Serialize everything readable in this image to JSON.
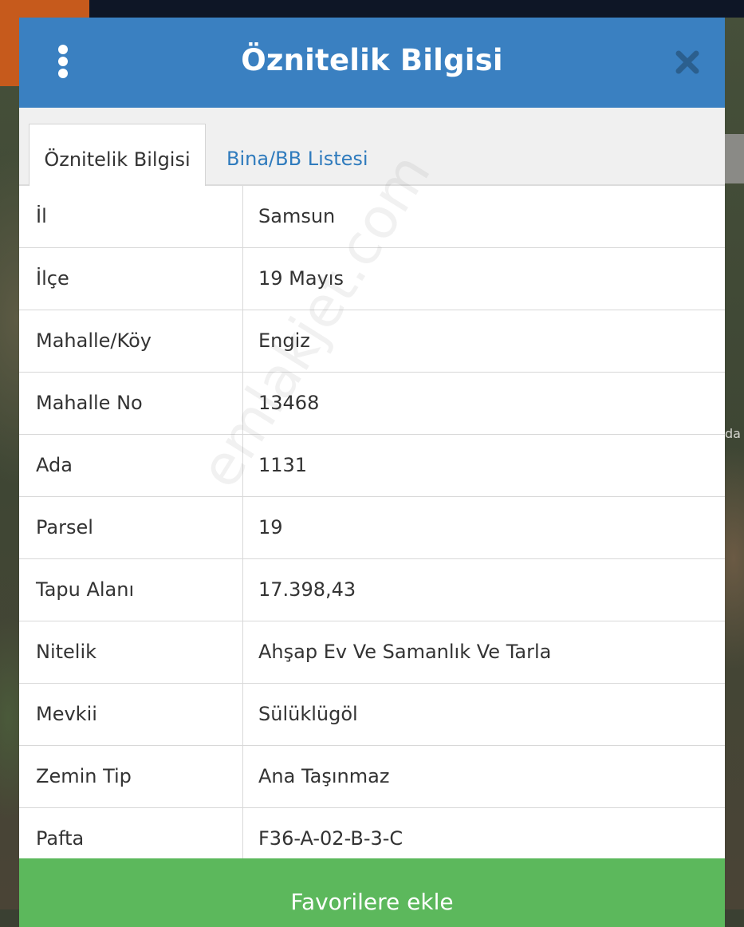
{
  "dialog": {
    "title": "Öznitelik Bilgisi",
    "menu_icon": "vertical-dots-icon",
    "close_icon": "close-icon"
  },
  "tabs": [
    {
      "label": "Öznitelik Bilgisi",
      "active": true
    },
    {
      "label": "Bina/BB Listesi",
      "active": false
    }
  ],
  "attributes": [
    {
      "label": "İl",
      "value": "Samsun"
    },
    {
      "label": "İlçe",
      "value": "19 Mayıs"
    },
    {
      "label": "Mahalle/Köy",
      "value": "Engiz"
    },
    {
      "label": "Mahalle No",
      "value": "13468"
    },
    {
      "label": "Ada",
      "value": "1131"
    },
    {
      "label": "Parsel",
      "value": "19"
    },
    {
      "label": "Tapu Alanı",
      "value": "17.398,43"
    },
    {
      "label": "Nitelik",
      "value": "Ahşap Ev Ve Samanlık Ve Tarla"
    },
    {
      "label": "Mevkii",
      "value": "Sülüklügöl"
    },
    {
      "label": "Zemin Tip",
      "value": "Ana Taşınmaz"
    },
    {
      "label": "Pafta",
      "value": "F36-A-02-B-3-C"
    }
  ],
  "favorite_button": {
    "label": "Favorilere ekle"
  },
  "watermark": "emlakjet.com",
  "map": {
    "edge_label": "da"
  },
  "colors": {
    "header": "#3a80c1",
    "tab_link": "#2f7bbd",
    "button": "#5cb85c"
  }
}
